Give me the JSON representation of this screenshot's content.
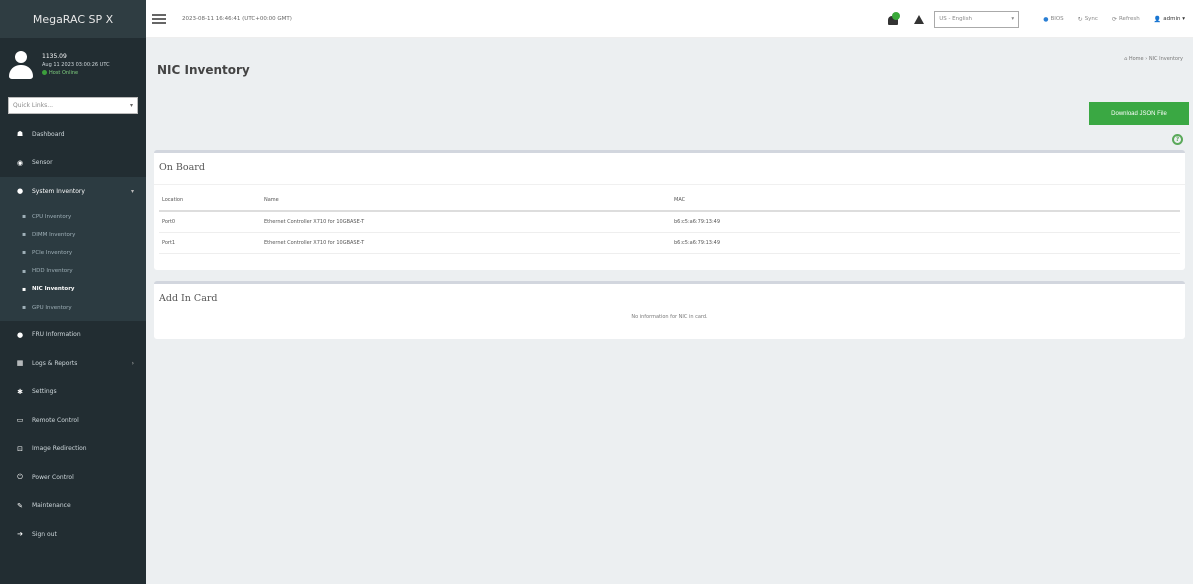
{
  "app": {
    "brand": "MegaRAC SP X"
  },
  "user": {
    "name": "1135.09",
    "last_login": "Aug 11 2023 03:00:26 UTC",
    "status": "Host Online"
  },
  "sidebar": {
    "quicklinks_placeholder": "Quick Links...",
    "menu": [
      {
        "label": "Dashboard",
        "icon": "dashboard-icon",
        "glyph": "☗"
      },
      {
        "label": "Sensor",
        "icon": "sensor-icon",
        "glyph": "◉"
      },
      {
        "label": "System Inventory",
        "icon": "inventory-icon",
        "glyph": "●"
      }
    ],
    "submenu": [
      {
        "label": "CPU Inventory"
      },
      {
        "label": "DIMM Inventory"
      },
      {
        "label": "PCIe Inventory"
      },
      {
        "label": "HDD Inventory"
      },
      {
        "label": "NIC Inventory"
      },
      {
        "label": "GPU Inventory"
      }
    ],
    "menu2": [
      {
        "label": "FRU Information",
        "icon": "fru-icon",
        "glyph": "●"
      },
      {
        "label": "Logs & Reports",
        "icon": "chart-icon",
        "glyph": "▦"
      },
      {
        "label": "Settings",
        "icon": "settings-icon",
        "glyph": "✱"
      },
      {
        "label": "Remote Control",
        "icon": "monitor-icon",
        "glyph": "▭"
      },
      {
        "label": "Image Redirection",
        "icon": "image-icon",
        "glyph": "⊡"
      },
      {
        "label": "Power Control",
        "icon": "power-icon",
        "glyph": "⏻"
      },
      {
        "label": "Maintenance",
        "icon": "wrench-icon",
        "glyph": "✎"
      },
      {
        "label": "Sign out",
        "icon": "signout-icon",
        "glyph": "➔"
      }
    ]
  },
  "header": {
    "datetime": "2023-08-11 16:46:41 (UTC+00:00 GMT)",
    "language": "US - English",
    "bios": "BIOS",
    "sync": "Sync",
    "refresh": "Refresh",
    "user": "admin"
  },
  "page": {
    "title": "NIC Inventory",
    "breadcrumb": [
      "Home",
      "NIC Inventory"
    ],
    "download_label": "Download JSON File",
    "help": "?"
  },
  "onboard": {
    "title": "On Board",
    "columns": [
      "Location",
      "Name",
      "MAC"
    ],
    "rows": [
      [
        "Port0",
        "Ethernet Controller X710 for 10GBASE-T",
        "b6:c5:a6:79:13:49"
      ],
      [
        "Port1",
        "Ethernet Controller X710 for 10GBASE-T",
        "b6:c5:a6:79:13:49"
      ]
    ]
  },
  "addin": {
    "title": "Add In Card",
    "empty_text": "No information for NIC in card."
  },
  "colors": {
    "sidebar_bg": "#222d32",
    "accent_green": "#3aa843",
    "content_bg": "#eceff1"
  }
}
